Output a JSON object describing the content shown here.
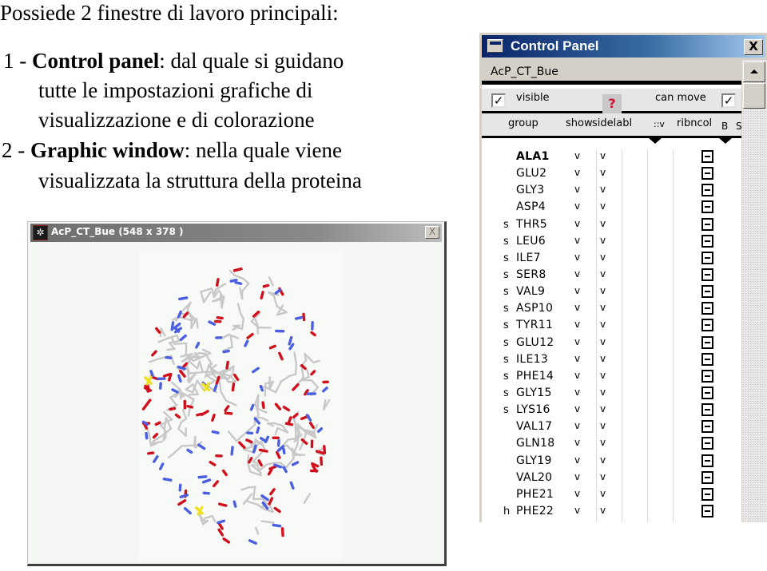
{
  "slide": {
    "title": "Possiede 2 finestre di lavoro principali:",
    "items": [
      {
        "number": "1 - ",
        "term": "Control panel",
        "lines": [
          ": dal quale si guidano",
          "tutte le impostazioni grafiche di",
          "visualizzazione e di colorazione"
        ]
      },
      {
        "number": "2 - ",
        "term": "Graphic window",
        "lines": [
          ": nella quale viene",
          "visualizzata la struttura della proteina"
        ]
      }
    ]
  },
  "control_panel": {
    "title": "Control Panel",
    "close_label": "X",
    "molecule_name": "AcP_CT_Bue",
    "visible_label": "visible",
    "visible_checked": true,
    "can_move_label": "can move",
    "can_move_checked": true,
    "help_label": "?",
    "columns": {
      "group": "group",
      "show": "show",
      "side": "sidelabl",
      "v": "::v",
      "ribncol": "ribncol",
      "bs": "B S"
    },
    "residues": [
      {
        "flag": "",
        "name": "ALA1",
        "show": "v",
        "side": "v",
        "bold": true
      },
      {
        "flag": "",
        "name": "GLU2",
        "show": "v",
        "side": "v"
      },
      {
        "flag": "",
        "name": "GLY3",
        "show": "v",
        "side": "v"
      },
      {
        "flag": "",
        "name": "ASP4",
        "show": "v",
        "side": "v"
      },
      {
        "flag": "s",
        "name": "THR5",
        "show": "v",
        "side": "v"
      },
      {
        "flag": "s",
        "name": "LEU6",
        "show": "v",
        "side": "v"
      },
      {
        "flag": "s",
        "name": "ILE7",
        "show": "v",
        "side": "v"
      },
      {
        "flag": "s",
        "name": "SER8",
        "show": "v",
        "side": "v"
      },
      {
        "flag": "s",
        "name": "VAL9",
        "show": "v",
        "side": "v"
      },
      {
        "flag": "s",
        "name": "ASP10",
        "show": "v",
        "side": "v"
      },
      {
        "flag": "s",
        "name": "TYR11",
        "show": "v",
        "side": "v"
      },
      {
        "flag": "s",
        "name": "GLU12",
        "show": "v",
        "side": "v"
      },
      {
        "flag": "s",
        "name": "ILE13",
        "show": "v",
        "side": "v"
      },
      {
        "flag": "s",
        "name": "PHE14",
        "show": "v",
        "side": "v"
      },
      {
        "flag": "s",
        "name": "GLY15",
        "show": "v",
        "side": "v"
      },
      {
        "flag": "s",
        "name": "LYS16",
        "show": "v",
        "side": "v"
      },
      {
        "flag": "",
        "name": "VAL17",
        "show": "v",
        "side": "v"
      },
      {
        "flag": "",
        "name": "GLN18",
        "show": "v",
        "side": "v"
      },
      {
        "flag": "",
        "name": "GLY19",
        "show": "v",
        "side": "v"
      },
      {
        "flag": "",
        "name": "VAL20",
        "show": "v",
        "side": "v"
      },
      {
        "flag": "",
        "name": "PHE21",
        "show": "v",
        "side": "v"
      },
      {
        "flag": "h",
        "name": "PHE22",
        "show": "v",
        "side": "v"
      }
    ]
  },
  "graphic_window": {
    "title": "AcP_CT_Bue  (548 x 378 )",
    "close_label": "X",
    "icon": "molecule-icon",
    "atom_colors": {
      "carbon": "#c8c8c8",
      "oxygen": "#d0101c",
      "nitrogen": "#4a5ee0",
      "sulfur": "#f0e020"
    }
  }
}
